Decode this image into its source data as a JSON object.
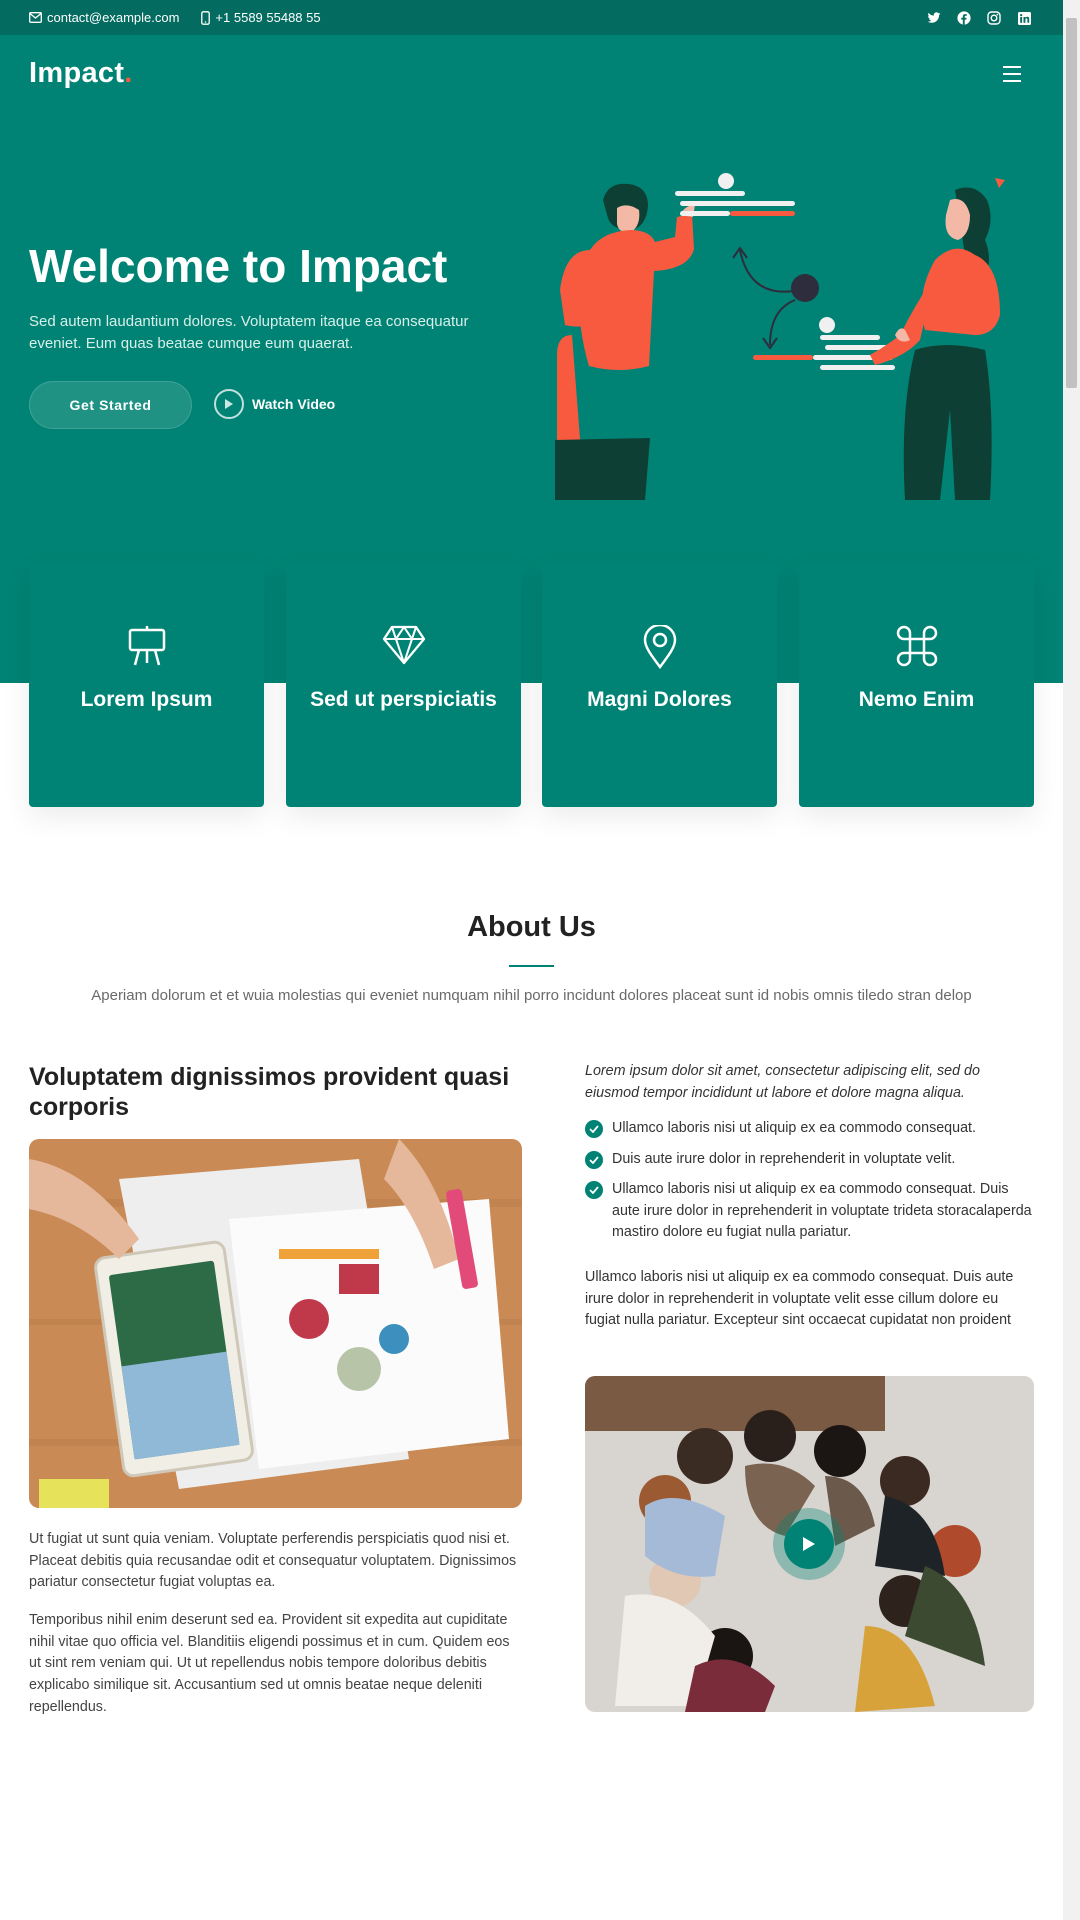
{
  "topbar": {
    "email": "contact@example.com",
    "phone": "+1 5589 55488 55",
    "social_icons": [
      "twitter-icon",
      "facebook-icon",
      "instagram-icon",
      "linkedin-icon"
    ]
  },
  "header": {
    "logo": "Impact",
    "logo_dot": "."
  },
  "hero": {
    "title": "Welcome to Impact",
    "description": "Sed autem laudantium dolores. Voluptatem itaque ea consequatur eveniet. Eum quas beatae cumque eum quaerat.",
    "cta_label": "Get Started",
    "video_label": "Watch Video"
  },
  "features": [
    {
      "icon": "easel-icon",
      "title": "Lorem Ipsum"
    },
    {
      "icon": "gem-icon",
      "title": "Sed ut perspiciatis"
    },
    {
      "icon": "geo-pin-icon",
      "title": "Magni Dolores"
    },
    {
      "icon": "command-icon",
      "title": "Nemo Enim"
    }
  ],
  "about": {
    "title": "About Us",
    "subtitle": "Aperiam dolorum et et wuia molestias qui eveniet numquam nihil porro incidunt dolores placeat sunt id nobis omnis tiledo stran delop",
    "left_heading": "Voluptatem dignissimos provident quasi corporis",
    "left_p1": "Ut fugiat ut sunt quia veniam. Voluptate perferendis perspiciatis quod nisi et. Placeat debitis quia recusandae odit et consequatur voluptatem. Dignissimos pariatur consectetur fugiat voluptas ea.",
    "left_p2": "Temporibus nihil enim deserunt sed ea. Provident sit expedita aut cupiditate nihil vitae quo officia vel. Blanditiis eligendi possimus et in cum. Quidem eos ut sint rem veniam qui. Ut ut repellendus nobis tempore doloribus debitis explicabo similique sit. Accusantium sed ut omnis beatae neque deleniti repellendus.",
    "right_intro": "Lorem ipsum dolor sit amet, consectetur adipiscing elit, sed do eiusmod tempor incididunt ut labore et dolore magna aliqua.",
    "list": [
      "Ullamco laboris nisi ut aliquip ex ea commodo consequat.",
      "Duis aute irure dolor in reprehenderit in voluptate velit.",
      "Ullamco laboris nisi ut aliquip ex ea commodo consequat. Duis aute irure dolor in reprehenderit in voluptate trideta storacalaperda mastiro dolore eu fugiat nulla pariatur."
    ],
    "right_p": "Ullamco laboris nisi ut aliquip ex ea commodo consequat. Duis aute irure dolor in reprehenderit in voluptate velit esse cillum dolore eu fugiat nulla pariatur. Excepteur sint occaecat cupidatat non proident"
  },
  "colors": {
    "brand": "#008374",
    "brand_dark": "#036b5f",
    "accent": "#f85a40"
  }
}
